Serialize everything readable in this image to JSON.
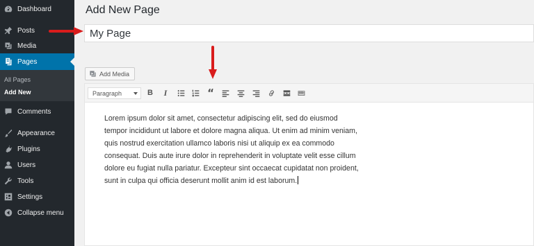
{
  "sidebar": {
    "items": [
      {
        "label": "Dashboard",
        "icon": "dashboard-icon"
      },
      {
        "label": "Posts",
        "icon": "pushpin-icon"
      },
      {
        "label": "Media",
        "icon": "media-icon"
      },
      {
        "label": "Pages",
        "icon": "pages-icon"
      },
      {
        "label": "Comments",
        "icon": "comment-icon"
      },
      {
        "label": "Appearance",
        "icon": "paintbrush-icon"
      },
      {
        "label": "Plugins",
        "icon": "plug-icon"
      },
      {
        "label": "Users",
        "icon": "user-icon"
      },
      {
        "label": "Tools",
        "icon": "wrench-icon"
      },
      {
        "label": "Settings",
        "icon": "settings-icon"
      },
      {
        "label": "Collapse menu",
        "icon": "collapse-icon"
      }
    ],
    "submenu": [
      {
        "label": "All Pages"
      },
      {
        "label": "Add New"
      }
    ]
  },
  "main": {
    "page_title": "Add New Page",
    "title_value": "My Page",
    "add_media_label": "Add Media"
  },
  "editor": {
    "format_select": "Paragraph",
    "toolbar_buttons": [
      "bold-icon",
      "italic-icon",
      "bullet-list-icon",
      "numbered-list-icon",
      "blockquote-icon",
      "align-left-icon",
      "align-center-icon",
      "align-right-icon",
      "link-icon",
      "read-more-icon",
      "toolbar-toggle-icon"
    ],
    "content_lines": [
      "Lorem ipsum dolor sit amet, consectetur adipiscing elit, sed do eiusmod",
      "tempor incididunt ut labore et dolore magna aliqua. Ut enim ad minim veniam,",
      "quis nostrud exercitation ullamco laboris nisi ut aliquip ex ea commodo",
      "consequat. Duis aute irure dolor in reprehenderit in voluptate velit esse cillum",
      "dolore eu fugiat nulla pariatur. Excepteur sint occaecat cupidatat non proident,",
      "sunt in culpa qui officia deserunt mollit anim id est laborum."
    ]
  },
  "colors": {
    "sidebar_bg": "#23282d",
    "active_bg": "#0073aa",
    "annotation_arrow": "#d91c1c"
  }
}
